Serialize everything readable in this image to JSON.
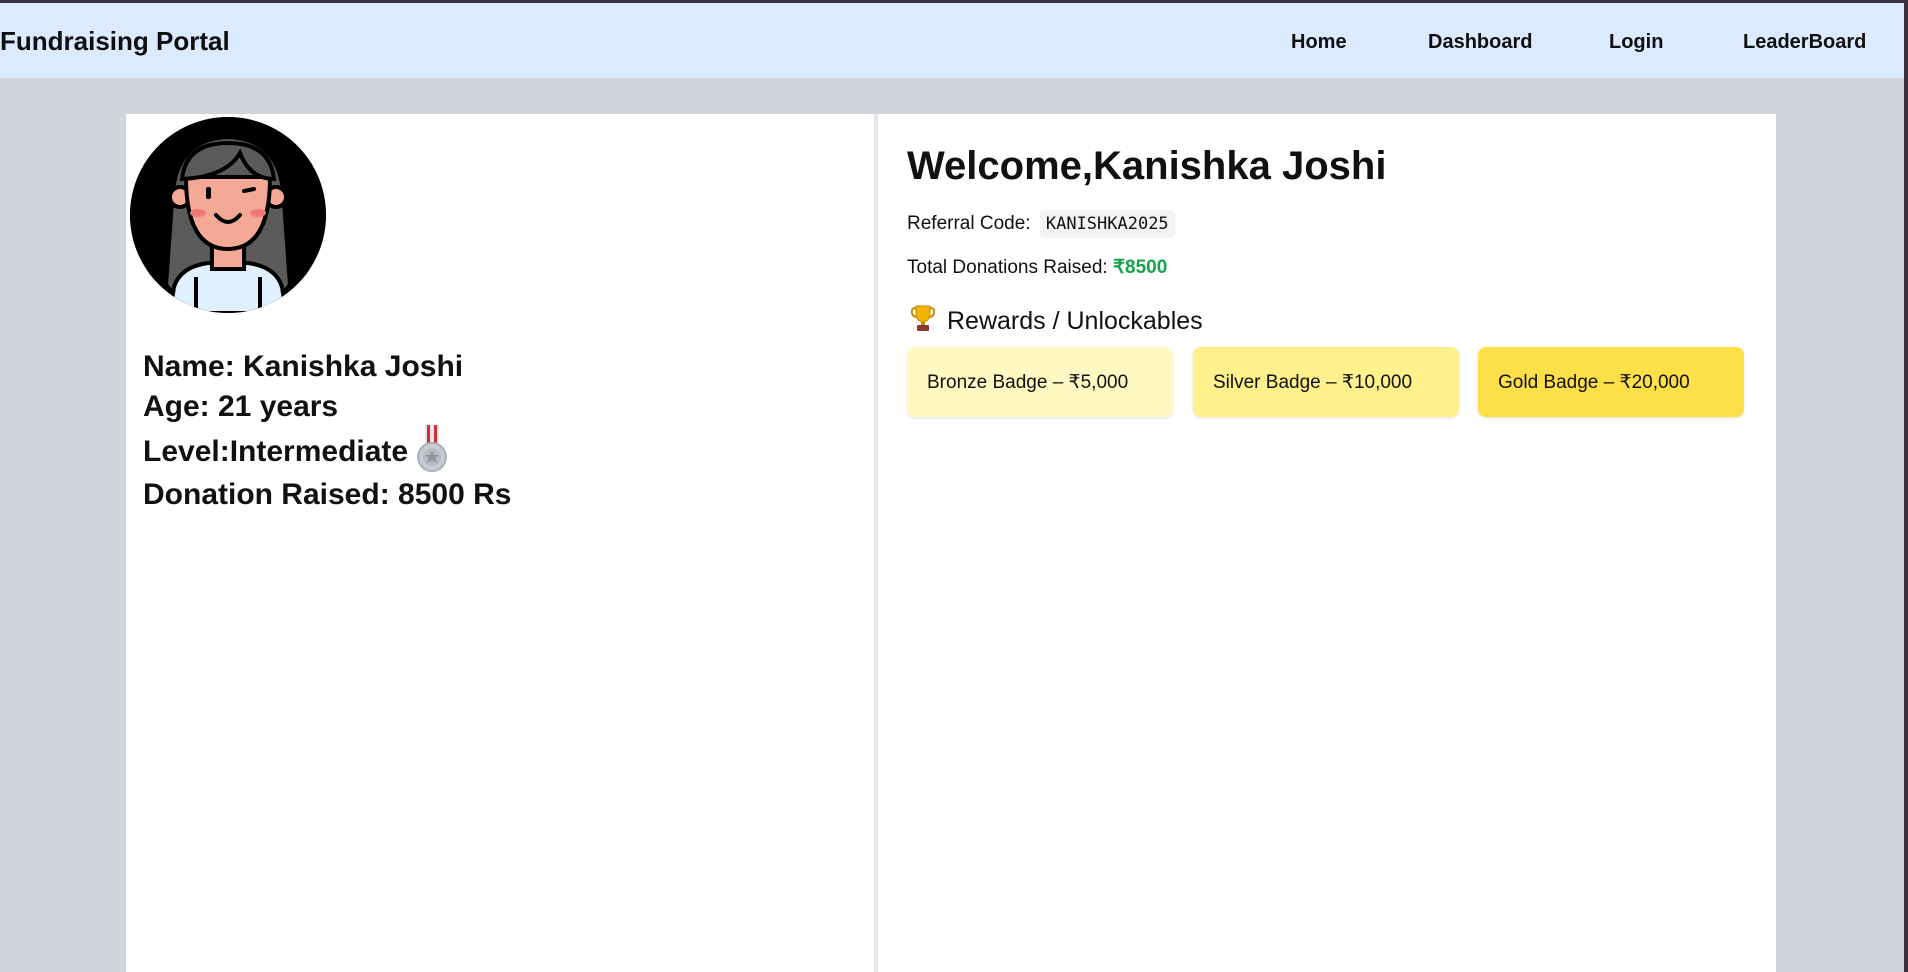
{
  "navbar": {
    "brand": "Fundraising Portal",
    "links": [
      "Home",
      "Dashboard",
      "Login",
      "LeaderBoard"
    ]
  },
  "profile": {
    "name_line": "Name: Kanishka Joshi",
    "age_line": "Age: 21 years",
    "level_line": "Level:Intermediate",
    "level_icon": "silver-medal-icon",
    "donation_line": "Donation Raised: 8500 Rs"
  },
  "dashboard": {
    "welcome": "Welcome,Kanishka Joshi",
    "referral_label": "Referral Code:",
    "referral_code": "KANISHKA2025",
    "total_label": "Total Donations Raised:",
    "total_amount": "₹8500",
    "rewards_icon": "trophy-icon",
    "rewards_title": "Rewards / Unlockables",
    "badges": [
      {
        "label": "Bronze Badge – ₹5,000",
        "color": "#fef9c3"
      },
      {
        "label": "Silver Badge – ₹10,000",
        "color": "#fef08a"
      },
      {
        "label": "Gold Badge – ₹20,000",
        "color": "#fde047"
      }
    ]
  },
  "colors": {
    "navbar_bg": "#dbeafe",
    "page_bg": "#d1d5db",
    "amount": "#16a34a"
  }
}
